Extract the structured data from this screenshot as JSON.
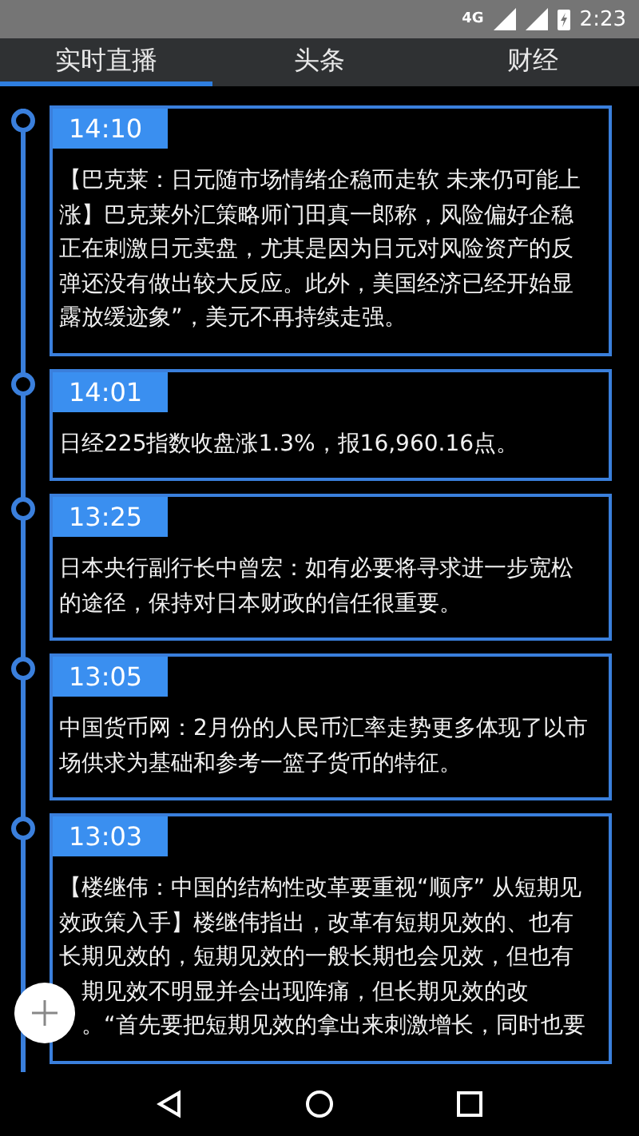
{
  "status_bar": {
    "network": "4G",
    "time": "2:23"
  },
  "tabs": [
    {
      "label": "实时直播",
      "selected": true
    },
    {
      "label": "头条",
      "selected": false
    },
    {
      "label": "财经",
      "selected": false
    }
  ],
  "feed": [
    {
      "time": "14:10",
      "lines": [
        {
          "text": "【巴克莱：日元随市场情绪企稳而走软 未来仍可能上"
        },
        {
          "text": "涨】巴克莱外汇策略师门田真一郎称，风险偏好企稳"
        },
        {
          "text": "正在刺激日元卖盘，尤其是因为日元对风险资产的反"
        },
        {
          "text": "弹还没有做出较大反应。此外，美国经济已经开始显"
        },
        {
          "text": "露放缓迹象”，美元不再持续走强。"
        }
      ]
    },
    {
      "time": "14:01",
      "lines": [
        {
          "text": "日经225指数收盘涨1.3%，报16,960.16点。"
        }
      ]
    },
    {
      "time": "13:25",
      "lines": [
        {
          "text": "日本央行副行长中曾宏：如有必要将寻求进一步宽松"
        },
        {
          "text": "的途径，保持对日本财政的信任很重要。"
        }
      ]
    },
    {
      "time": "13:05",
      "lines": [
        {
          "text": "中国货币网：2月份的人民币汇率走势更多体现了以市"
        },
        {
          "text": "场供求为基础和参考一篮子货币的特征。"
        }
      ]
    },
    {
      "time": "13:03",
      "lines": [
        {
          "text": "【楼继伟：中国的结构性改革要重视“顺序” 从短期见"
        },
        {
          "text": "效政策入手】楼继伟指出，改革有短期见效的、也有"
        },
        {
          "text": "长期见效的，短期见效的一般长期也会见效，但也有"
        },
        {
          "text": "期见效不明显并会出现阵痛，但长期见效的改",
          "covered": true
        },
        {
          "text": "。“首先要把短期见效的拿出来刺激增长，同时也要",
          "covered": true
        }
      ]
    }
  ]
}
